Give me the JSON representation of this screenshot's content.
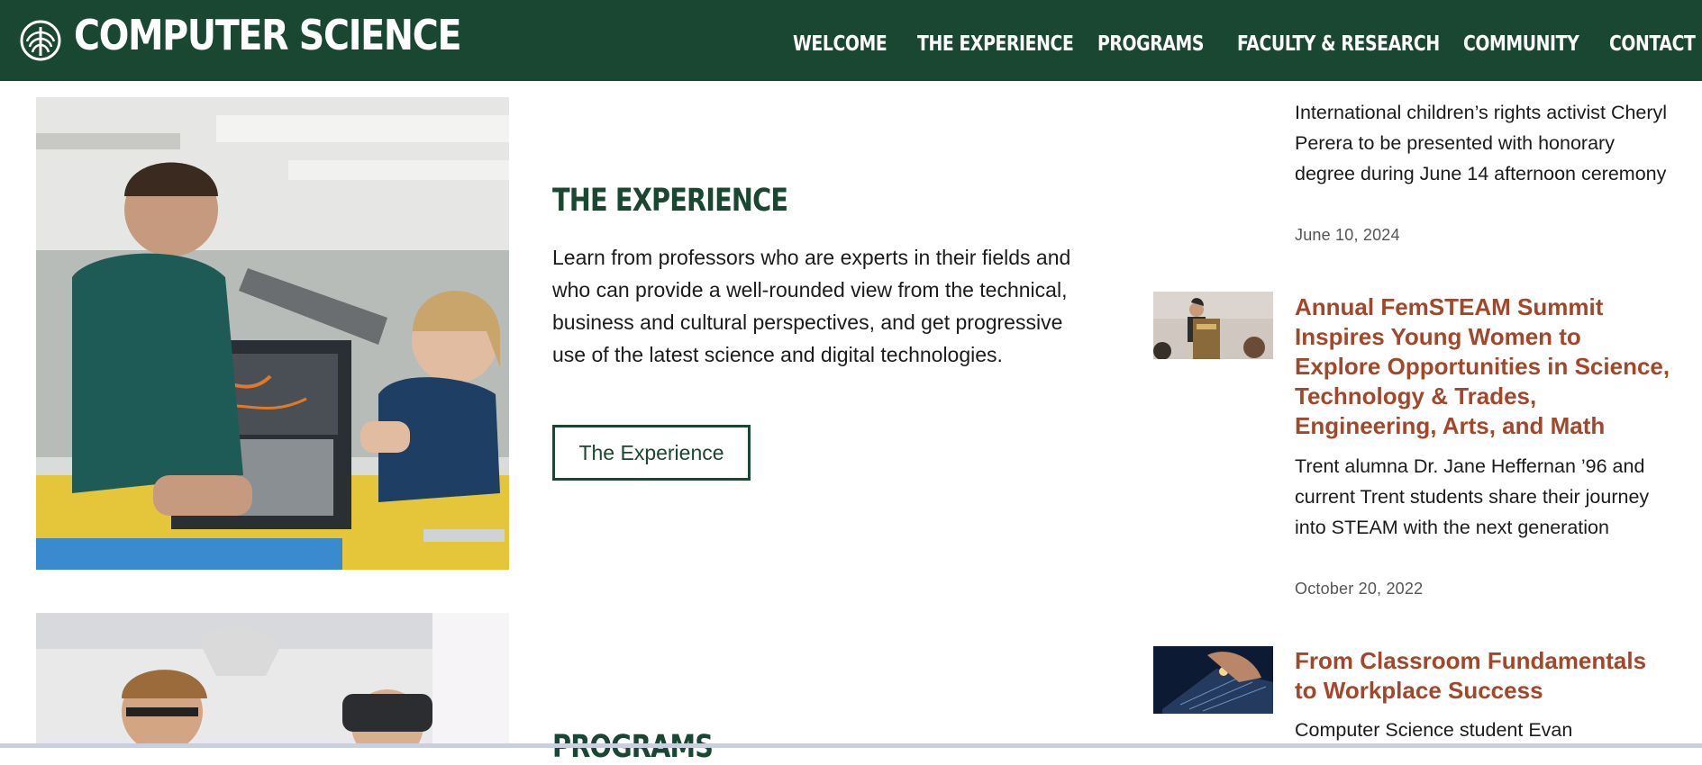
{
  "header": {
    "site_title": "COMPUTER SCIENCE",
    "nav": [
      {
        "label": "WELCOME"
      },
      {
        "label": "THE EXPERIENCE"
      },
      {
        "label": "PROGRAMS"
      },
      {
        "label": "FACULTY & RESEARCH"
      },
      {
        "label": "COMMUNITY"
      },
      {
        "label": "CONTACT"
      }
    ]
  },
  "experience": {
    "heading": "THE EXPERIENCE",
    "body": "Learn from professors who are experts in their fields and who can provide a well-rounded view from the technical, business and cultural perspectives, and get progressive use of the latest science and digital technologies.",
    "button_label": "The Experience"
  },
  "programs": {
    "heading": "PROGRAMS"
  },
  "news": {
    "items": [
      {
        "summary": "International children’s rights activist Cheryl Perera to be presented with honorary degree during June 14 afternoon ceremony",
        "date": "June 10, 2024"
      },
      {
        "title": "Annual FemSTEAM Summit Inspires Young Women to Explore Opportunities in Science, Technology & Trades, Engineering, Arts, and Math",
        "summary": "Trent alumna Dr. Jane Heffernan ’96 and current Trent students share their journey into STEAM with the next generation",
        "date": "October 20, 2022"
      },
      {
        "title": "From Classroom Fundamentals to Workplace Success",
        "summary": "Computer Science student Evan"
      }
    ]
  },
  "colors": {
    "brand_green": "#1a4731",
    "news_title": "#a3472a"
  }
}
